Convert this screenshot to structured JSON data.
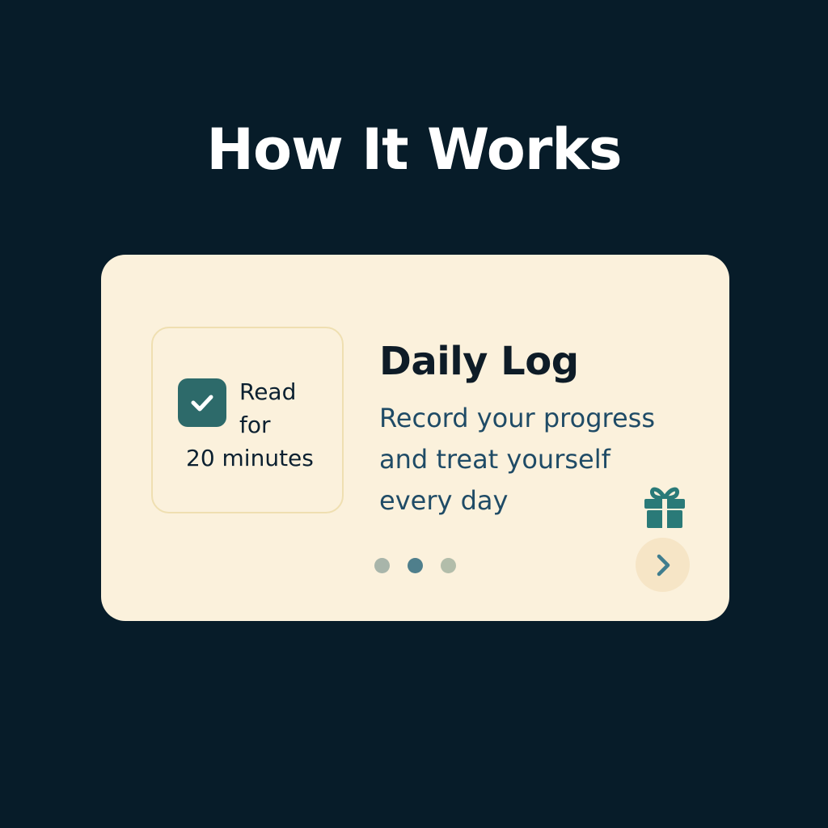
{
  "header": {
    "title": "How It Works"
  },
  "card": {
    "task": {
      "checked": true,
      "lines": [
        "Read",
        "for",
        "20 minutes"
      ]
    },
    "heading": "Daily Log",
    "description": [
      "Record your progress",
      "and treat yourself",
      "every day"
    ],
    "icons": {
      "checkbox": "check-icon",
      "reward": "gift-icon",
      "next": "chevron-right-icon"
    },
    "pagination": {
      "total": 3,
      "active": 2
    }
  },
  "colors": {
    "background": "#071c29",
    "card": "#fbf1dc",
    "accent": "#2d6a6a",
    "gift": "#2a7a78"
  }
}
